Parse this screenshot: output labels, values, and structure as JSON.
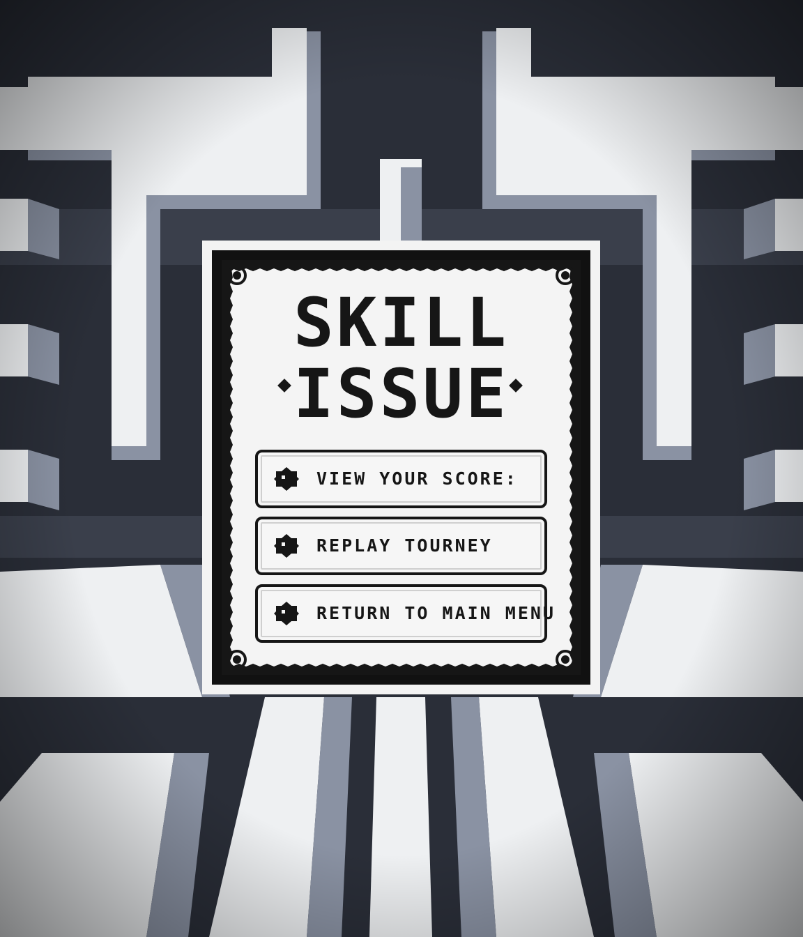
{
  "dialog": {
    "title_line1": "SKILL",
    "title_line2": "ISSUE",
    "menu": [
      {
        "label": "VIEW YOUR SCORE:"
      },
      {
        "label": "REPLAY TOURNEY"
      },
      {
        "label": "RETURN TO MAIN MENU"
      }
    ]
  },
  "colors": {
    "ink": "#161616",
    "paper": "#f4f4f4",
    "maze_dark": "#2a2e38",
    "maze_light": "#eef0f2",
    "maze_side": "#8a92a3"
  }
}
